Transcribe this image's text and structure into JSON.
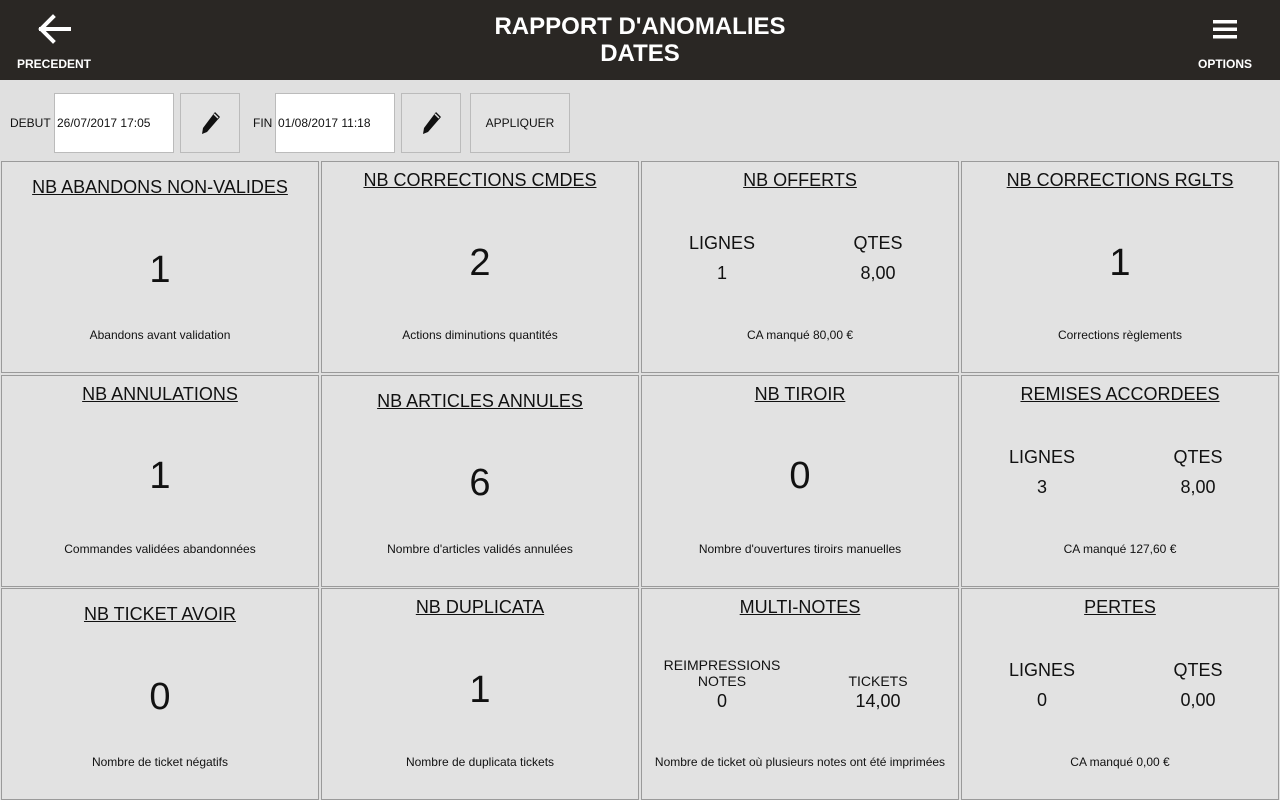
{
  "header": {
    "back_label": "PRECEDENT",
    "title_line1": "RAPPORT D'ANOMALIES",
    "title_line2": "DATES",
    "options_label": "OPTIONS"
  },
  "filters": {
    "start_label": "DEBUT",
    "start_value": "26/07/2017 17:05",
    "end_label": "FIN",
    "end_value": "01/08/2017 11:18",
    "apply_label": "APPLIQUER"
  },
  "tiles": {
    "abandons": {
      "title": "NB ABANDONS NON-VALIDES",
      "value": "1",
      "caption": "Abandons avant validation"
    },
    "corrections_cmdes": {
      "title": "NB CORRECTIONS CMDES",
      "value": "2",
      "caption": "Actions diminutions quantités"
    },
    "offerts": {
      "title": "NB OFFERTS",
      "col1_label": "LIGNES",
      "col1_value": "1",
      "col2_label": "QTES",
      "col2_value": "8,00",
      "caption": "CA manqué 80,00 €"
    },
    "corrections_rglts": {
      "title": "NB CORRECTIONS RGLTS",
      "value": "1",
      "caption": "Corrections règlements"
    },
    "annulations": {
      "title": "NB ANNULATIONS",
      "value": "1",
      "caption": "Commandes validées abandonnées"
    },
    "articles_annules": {
      "title": "NB ARTICLES ANNULES",
      "value": "6",
      "caption": "Nombre d'articles validés annulées"
    },
    "tiroir": {
      "title": "NB TIROIR",
      "value": "0",
      "caption": "Nombre d'ouvertures tiroirs manuelles"
    },
    "remises": {
      "title": "REMISES ACCORDEES",
      "col1_label": "LIGNES",
      "col1_value": "3",
      "col2_label": "QTES",
      "col2_value": "8,00",
      "caption": "CA manqué 127,60 €"
    },
    "ticket_avoir": {
      "title": "NB TICKET AVOIR",
      "value": "0",
      "caption": "Nombre de ticket négatifs"
    },
    "duplicata": {
      "title": "NB DUPLICATA",
      "value": "1",
      "caption": "Nombre de duplicata tickets"
    },
    "multi_notes": {
      "title": "MULTI-NOTES",
      "col1_label_a": "REIMPRESSIONS",
      "col1_label_b": "NOTES",
      "col1_value": "0",
      "col2_label": "TICKETS",
      "col2_value": "14,00",
      "caption": "Nombre de ticket où plusieurs notes ont été imprimées"
    },
    "pertes": {
      "title": "PERTES",
      "col1_label": "LIGNES",
      "col1_value": "0",
      "col2_label": "QTES",
      "col2_value": "0,00",
      "caption": "CA manqué 0,00 €"
    }
  },
  "colors": {
    "header_bg": "#2a2724",
    "page_bg": "#e0e0e0"
  },
  "icons": {
    "back": "arrow-left-icon",
    "options": "hamburger-menu-icon",
    "edit": "pencil-icon"
  }
}
